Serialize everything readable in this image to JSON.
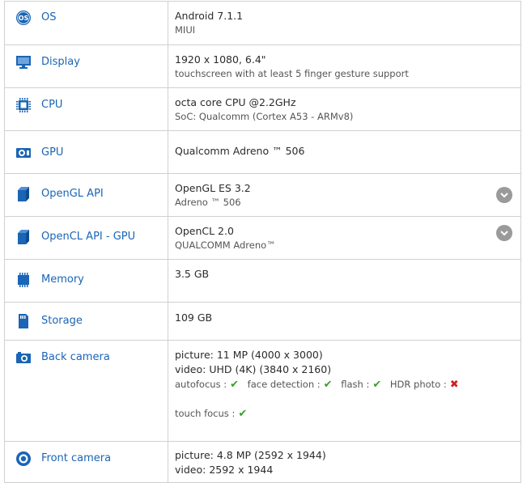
{
  "rows": {
    "os": {
      "label": "OS",
      "icon": "os-icon",
      "primary": "Android 7.1.1",
      "secondary": "MIUI"
    },
    "display": {
      "label": "Display",
      "icon": "monitor-icon",
      "primary": "1920 x 1080, 6.4\"",
      "secondary": "touchscreen with at least 5 finger gesture support"
    },
    "cpu": {
      "label": "CPU",
      "icon": "cpu-chip-icon",
      "primary": "octa core CPU @2.2GHz",
      "secondary": "SoC: Qualcomm (Cortex A53 - ARMv8)"
    },
    "gpu": {
      "label": "GPU",
      "icon": "gpu-icon",
      "primary": "Qualcomm Adreno ™ 506"
    },
    "opengl": {
      "label": "OpenGL API",
      "icon": "cube-icon",
      "primary": "OpenGL ES 3.2",
      "secondary": "Adreno ™ 506",
      "expand_icon": "chevron-down-icon"
    },
    "opencl": {
      "label": "OpenCL API - GPU",
      "icon": "cube-icon",
      "primary": "OpenCL 2.0",
      "secondary": "QUALCOMM Adreno™",
      "expand_icon": "chevron-down-icon"
    },
    "memory": {
      "label": "Memory",
      "icon": "memory-icon",
      "primary": "3.5 GB"
    },
    "storage": {
      "label": "Storage",
      "icon": "sd-card-icon",
      "primary": "109 GB"
    },
    "back_camera": {
      "label": "Back camera",
      "icon": "camera-icon",
      "picture": "picture: 11 MP (4000 x 3000)",
      "video": "video: UHD (4K) (3840 x 2160)",
      "features": [
        {
          "label": "autofocus :",
          "supported": true
        },
        {
          "label": "face detection :",
          "supported": true
        },
        {
          "label": "flash :",
          "supported": true
        },
        {
          "label": "HDR photo :",
          "supported": false
        }
      ],
      "touch_focus": {
        "label": "touch focus :",
        "supported": true
      }
    },
    "front_camera": {
      "label": "Front camera",
      "icon": "front-camera-icon",
      "picture": "picture: 4.8 MP (2592 x 1944)",
      "video": "video: 2592 x 1944"
    }
  },
  "colors": {
    "label": "#1a65b5",
    "icon": "#1a65b5",
    "tick": "#3aa02c",
    "cross": "#d02020",
    "border": "#d0d0d0"
  }
}
